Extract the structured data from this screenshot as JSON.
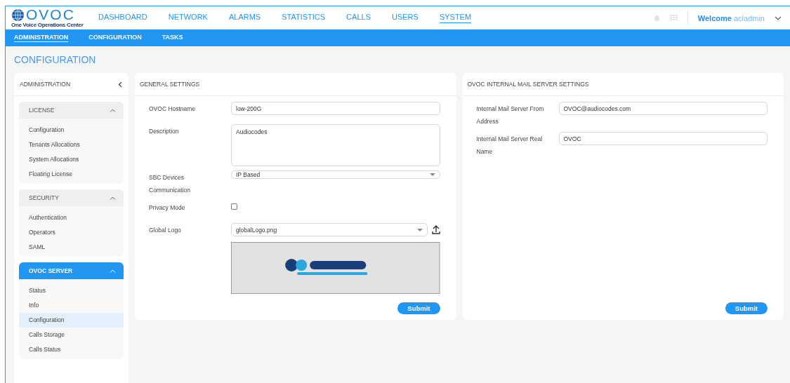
{
  "brand": {
    "name": "OVOC",
    "tagline": "One Voice Operations Center"
  },
  "nav": [
    {
      "label": "DASHBOARD",
      "selected": false
    },
    {
      "label": "NETWORK",
      "selected": false
    },
    {
      "label": "ALARMS",
      "selected": false
    },
    {
      "label": "STATISTICS",
      "selected": false
    },
    {
      "label": "CALLS",
      "selected": false
    },
    {
      "label": "USERS",
      "selected": false
    },
    {
      "label": "SYSTEM",
      "selected": true
    }
  ],
  "user": {
    "greeting": "Welcome",
    "name": "acladmin"
  },
  "subnav": [
    {
      "label": "ADMINISTRATION",
      "selected": true
    },
    {
      "label": "CONFIGURATION",
      "selected": false
    },
    {
      "label": "TASKS",
      "selected": false
    }
  ],
  "page_title": "CONFIGURATION",
  "sidebar": {
    "title": "ADMINISTRATION",
    "sections": [
      {
        "title": "LICENSE",
        "expanded": true,
        "selected": false,
        "items": [
          {
            "label": "Configuration",
            "selected": false
          },
          {
            "label": "Tenants Allocations",
            "selected": false
          },
          {
            "label": "System Allocations",
            "selected": false
          },
          {
            "label": "Floating License",
            "selected": false
          }
        ]
      },
      {
        "title": "SECURITY",
        "expanded": true,
        "selected": false,
        "items": [
          {
            "label": "Authentication",
            "selected": false
          },
          {
            "label": "Operators",
            "selected": false
          },
          {
            "label": "SAML",
            "selected": false
          }
        ]
      },
      {
        "title": "OVOC SERVER",
        "expanded": true,
        "selected": true,
        "items": [
          {
            "label": "Status",
            "selected": false
          },
          {
            "label": "Info",
            "selected": false
          },
          {
            "label": "Configuration",
            "selected": true
          },
          {
            "label": "Calls Storage",
            "selected": false
          },
          {
            "label": "Calls Status",
            "selected": false
          }
        ]
      }
    ]
  },
  "panels": [
    {
      "title": "GENERAL SETTINGS",
      "fields": [
        {
          "kind": "text",
          "label": "OVOC Hostname",
          "value": "low-200G"
        },
        {
          "kind": "textarea",
          "label": "Description",
          "value": "Audiocodes"
        },
        {
          "kind": "select",
          "label": "SBC Devices Communication",
          "value": "IP Based"
        },
        {
          "kind": "checkbox",
          "label": "Privacy Mode",
          "checked": false
        },
        {
          "kind": "file",
          "label": "Global Logo",
          "value": "globalLogo.png"
        }
      ],
      "submit": "Submit"
    },
    {
      "title": "OVOC INTERNAL MAIL SERVER SETTINGS",
      "fields": [
        {
          "kind": "text",
          "label": "Internal Mail Server From Address",
          "value": "OVOC@audiocodes.com"
        },
        {
          "kind": "text",
          "label": "Internal Mail Server Real Name",
          "value": "OVOC"
        }
      ],
      "submit": "Submit"
    }
  ]
}
